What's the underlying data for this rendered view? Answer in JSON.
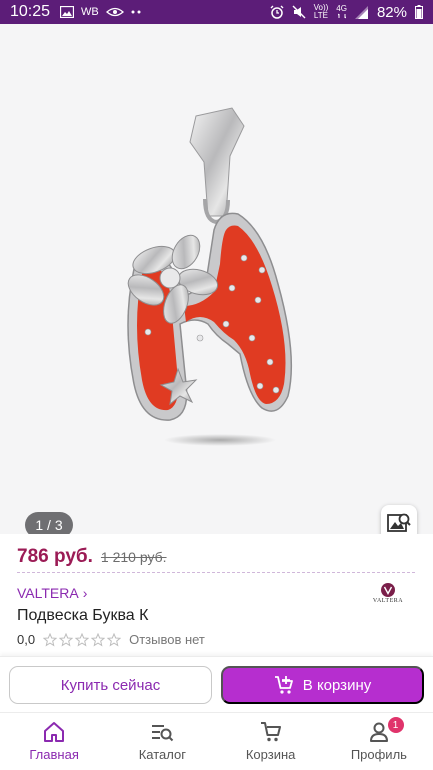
{
  "status_bar": {
    "time": "10:25",
    "carrier_tag": "WB",
    "network_lines": [
      "Vo))",
      "LTE"
    ],
    "network_type": "4G",
    "battery": "82%",
    "icons": [
      "image-icon",
      "wb-icon",
      "eye-icon",
      "dots-icon",
      "alarm-icon",
      "mute-icon",
      "signal-icon",
      "battery-icon"
    ]
  },
  "gallery": {
    "counter": "1 / 3",
    "visual_search_icon": "image-search-icon",
    "background": "#f5f5f6"
  },
  "product": {
    "price_current": "786 руб.",
    "price_old": "1 210 руб.",
    "brand": "VALTERA",
    "brand_chevron": "›",
    "brand_logo_text": "VALTERA",
    "title": "Подвеска Буква К",
    "rating_value": "0,0",
    "rating_stars": 0,
    "rating_max": 5,
    "reviews": "Отзывов нет"
  },
  "actions": {
    "buy_now": "Купить сейчас",
    "add_to_cart": "В корзину",
    "cart_icon": "cart-plus-icon"
  },
  "nav": {
    "items": [
      {
        "label": "Главная",
        "icon": "home-icon",
        "active": true
      },
      {
        "label": "Каталог",
        "icon": "catalog-icon",
        "active": false
      },
      {
        "label": "Корзина",
        "icon": "cart-icon",
        "active": false
      },
      {
        "label": "Профиль",
        "icon": "profile-icon",
        "active": false,
        "badge": "1"
      }
    ]
  },
  "colors": {
    "status_bar": "#5c1d78",
    "accent": "#8b2ab0",
    "price": "#9b1b55",
    "cart_button": "#b62ecf",
    "badge": "#e0336b",
    "enamel": "#e03b22"
  }
}
